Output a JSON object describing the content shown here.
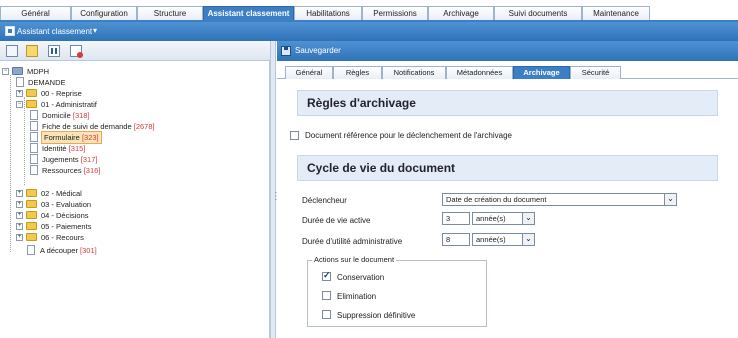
{
  "top_tabs": [
    "Général",
    "Configuration",
    "Structure",
    "Assistant classement",
    "Habilitations",
    "Permissions",
    "Archivage",
    "Suivi documents",
    "Maintenance"
  ],
  "top_active": "Assistant classement",
  "header": {
    "menu_label": "Assistant classement",
    "caret": "▾"
  },
  "left_toolbar_icons": [
    "new-folder-icon",
    "add-item-icon",
    "columns-icon",
    "delete-icon"
  ],
  "tree": {
    "root": "MDPH",
    "demande": "DEMANDE",
    "n00": "00 - Reprise",
    "n01": "01 - Administratif",
    "c_domicile": "Domicile",
    "c_domicile_count": "[318]",
    "c_fiche": "Fiche de suivi de demande",
    "c_fiche_count": "[2678]",
    "c_formulaire": "Formulaire",
    "c_formulaire_count": "[323]",
    "c_identite": "Identité",
    "c_identite_count": "[315]",
    "c_jugements": "Jugements",
    "c_jugements_count": "[317]",
    "c_ressources": "Ressources",
    "c_ressources_count": "[316]",
    "n02": "02 - Médical",
    "n03": "03 - Evaluation",
    "n04": "04 - Décisions",
    "n05": "05 - Paiements",
    "n06": "06 - Recours",
    "a_decouper": "A découper",
    "a_decouper_count": "[301]"
  },
  "right_toolbar": {
    "save_label": "Sauvegarder"
  },
  "sub_tabs": [
    "Général",
    "Règles",
    "Notifications",
    "Métadonnées",
    "Archivage",
    "Sécurité"
  ],
  "sub_active": "Archivage",
  "rules_title": "Règles d'archivage",
  "doc_ref_label": "Document référence pour le déclenchement de l'archivage",
  "doc_ref_checked": false,
  "cycle_title": "Cycle de vie du document",
  "declencheur_label": "Déclencheur",
  "declencheur_value": "Date de création du document",
  "duree_active_label": "Durée de vie active",
  "duree_active_value": "3",
  "duree_active_unit": "année(s)",
  "duree_admin_label": "Durée d'utilité administrative",
  "duree_admin_value": "8",
  "duree_admin_unit": "année(s)",
  "actions_legend": "Actions sur le document",
  "actions": [
    {
      "label": "Conservation",
      "checked": true
    },
    {
      "label": "Elimination",
      "checked": false
    },
    {
      "label": "Suppression définitive",
      "checked": false
    }
  ]
}
